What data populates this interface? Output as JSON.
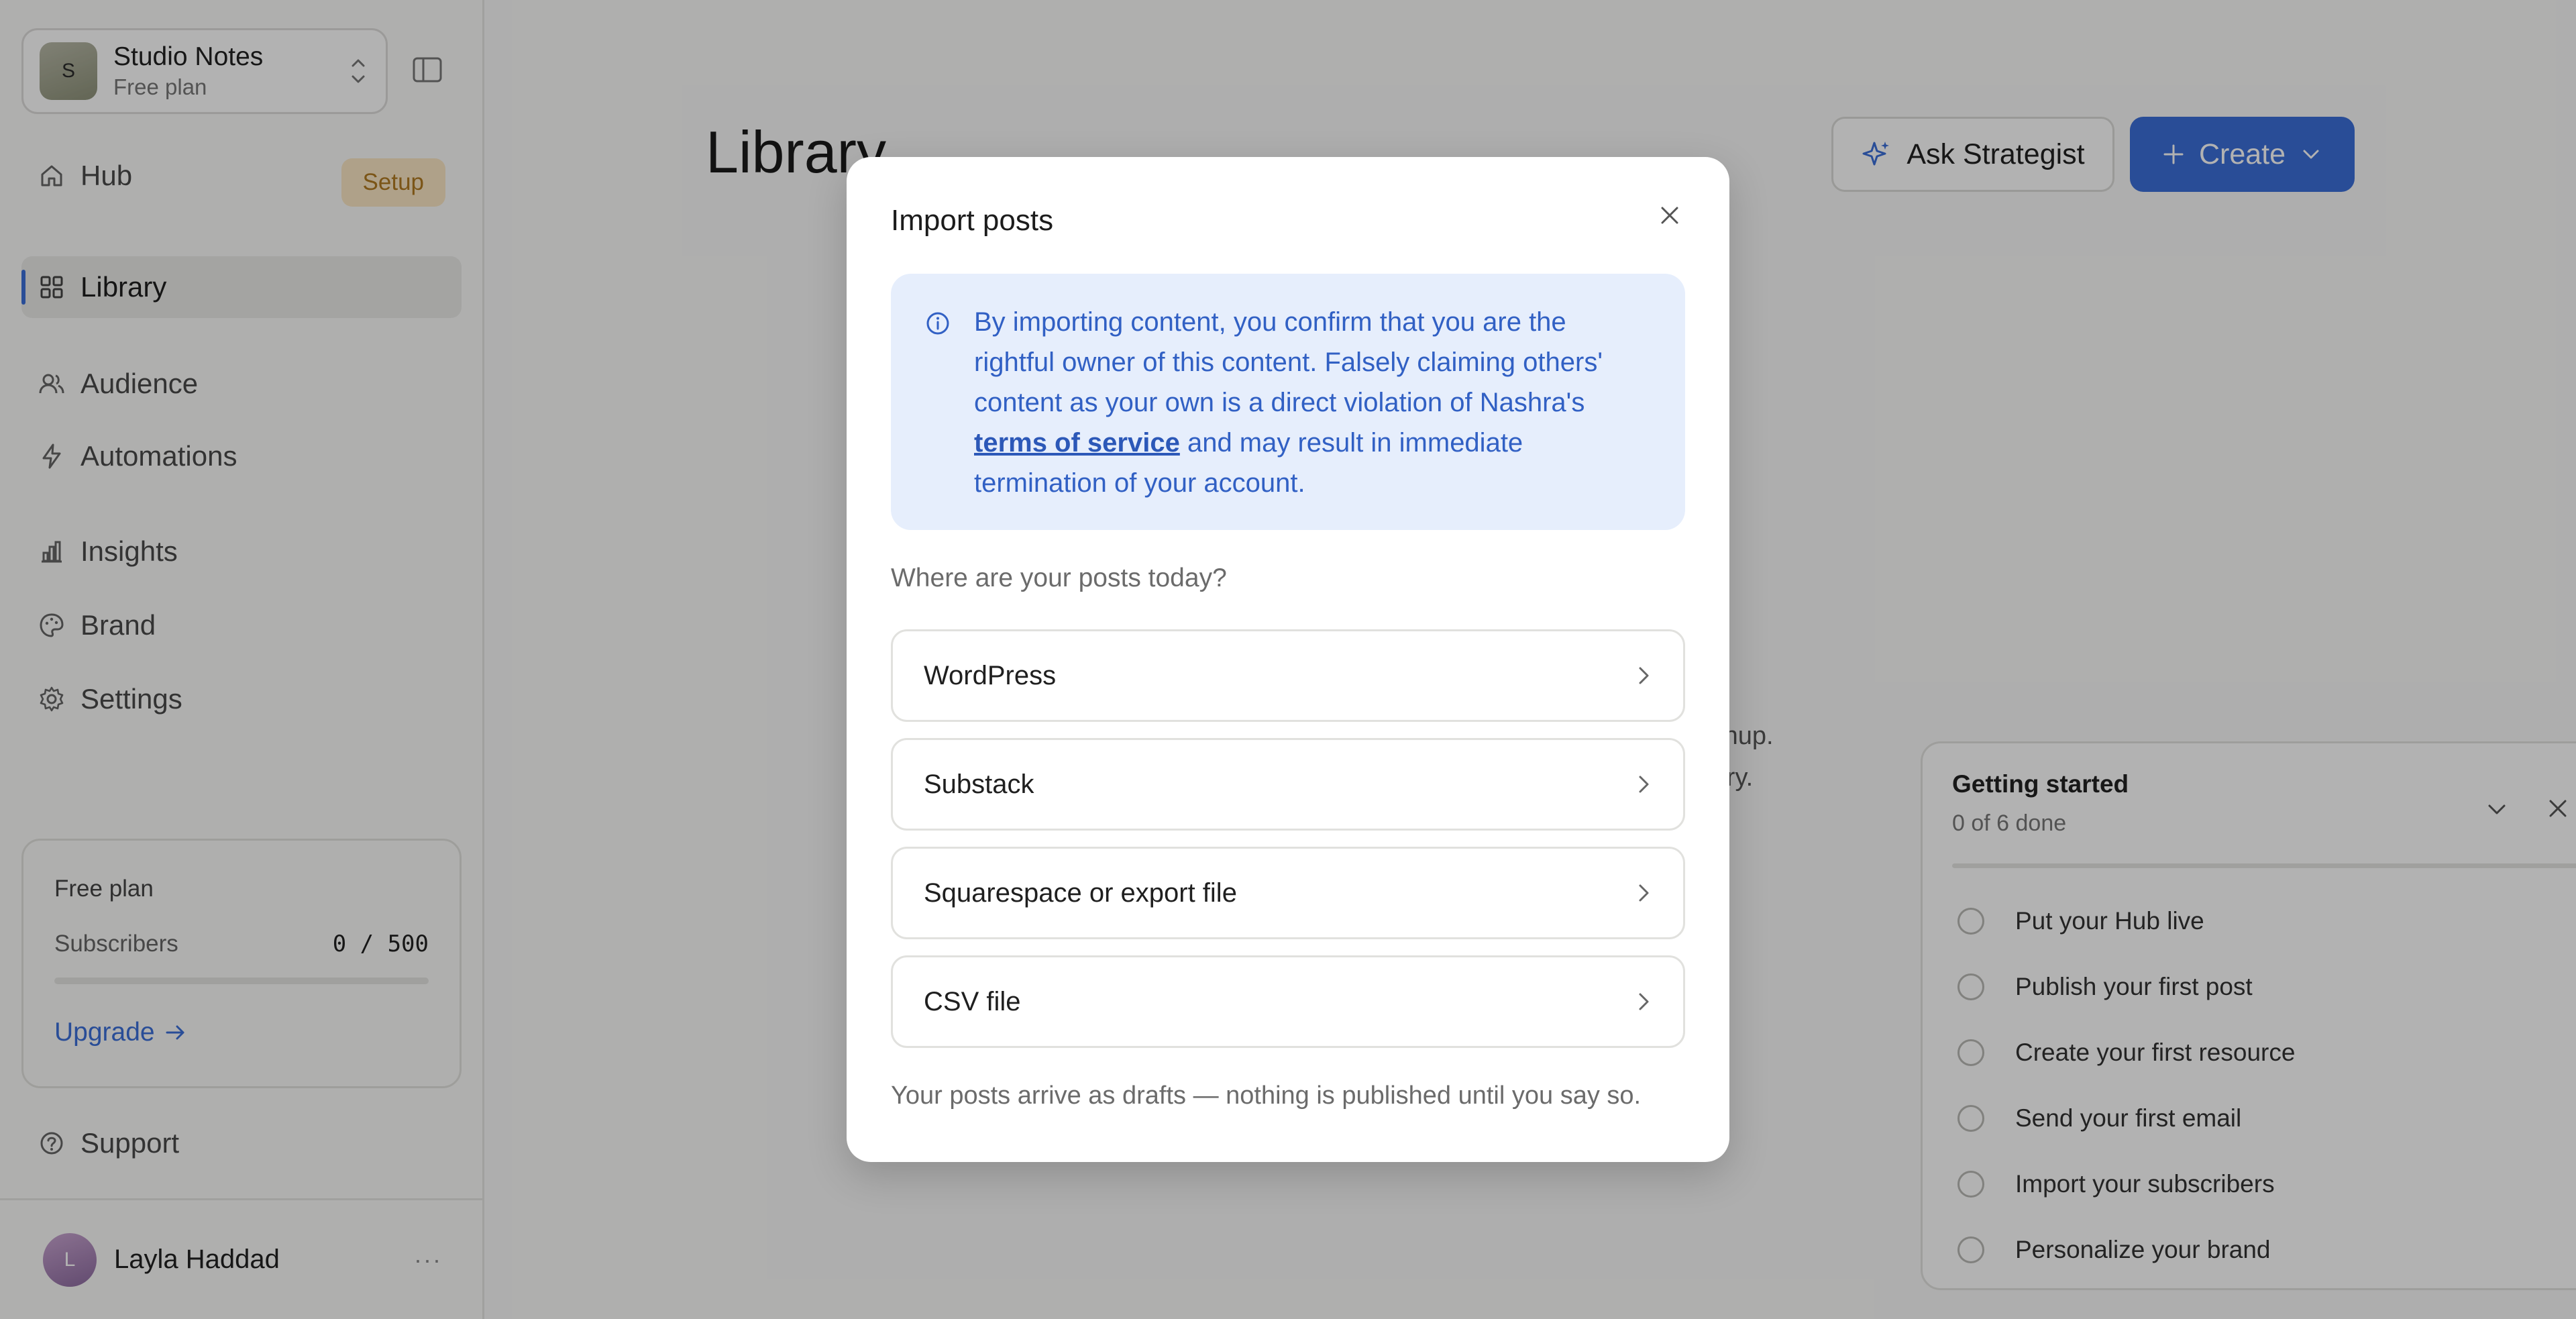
{
  "workspace": {
    "initial": "S",
    "name": "Studio Notes",
    "plan": "Free plan"
  },
  "nav": {
    "hub": {
      "label": "Hub",
      "badge": "Setup"
    },
    "library": {
      "label": "Library"
    },
    "audience": {
      "label": "Audience"
    },
    "automations": {
      "label": "Automations"
    },
    "insights": {
      "label": "Insights"
    },
    "brand": {
      "label": "Brand"
    },
    "settings": {
      "label": "Settings"
    },
    "support": {
      "label": "Support"
    }
  },
  "plan_card": {
    "title": "Free plan",
    "subscribers_label": "Subscribers",
    "subscribers_count": "0 / 500",
    "subscribers_fraction": 0,
    "upgrade_label": "Upgrade"
  },
  "user": {
    "initial": "L",
    "name": "Layla Haddad",
    "more": "···"
  },
  "main": {
    "title": "Library",
    "ask_label": "Ask Strategist",
    "create_label": "Create",
    "empty_line1": "ignup.",
    "empty_line2": "rary."
  },
  "getting_started": {
    "title": "Getting started",
    "progress_text": "0 of 6 done",
    "progress_fraction": 0,
    "items": [
      {
        "label": "Put your Hub live"
      },
      {
        "label": "Publish your first post"
      },
      {
        "label": "Create your first resource"
      },
      {
        "label": "Send your first email"
      },
      {
        "label": "Import your subscribers"
      },
      {
        "label": "Personalize your brand"
      }
    ]
  },
  "modal": {
    "title": "Import posts",
    "notice_before": "By importing content, you confirm that you are the rightful owner of this content. Falsely claiming others' content as your own is a direct violation of Nashra's ",
    "notice_link": "terms of service",
    "notice_after": " and may result in immediate termination of your account.",
    "question": "Where are your posts today?",
    "sources": [
      {
        "label": "WordPress"
      },
      {
        "label": "Substack"
      },
      {
        "label": "Squarespace or export file"
      },
      {
        "label": "CSV file"
      }
    ],
    "footnote": "Your posts arrive as drafts — nothing is published until you say so."
  },
  "colors": {
    "accent": "#3b6fd8",
    "setup_badge_bg": "#fbe7c5",
    "notice_bg": "#e6eefc",
    "notice_text": "#3160c4"
  }
}
